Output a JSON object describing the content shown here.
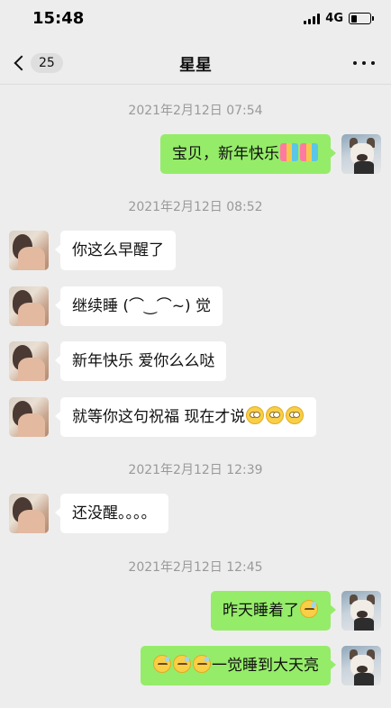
{
  "status_bar": {
    "time": "15:48",
    "network": "4G",
    "battery_level": 0.3
  },
  "nav": {
    "back_count": "25",
    "title": "星星"
  },
  "timestamps": [
    "2021年2月12日 07:54",
    "2021年2月12日 08:52",
    "2021年2月12日 12:39",
    "2021年2月12日 12:45"
  ],
  "messages": [
    {
      "side": "right",
      "text": "宝贝，新年快乐",
      "emojis": [
        "ribbon",
        "ribbon"
      ]
    },
    {
      "side": "left",
      "text": "你这么早醒了"
    },
    {
      "side": "left",
      "text": "继续睡 (⌒‿⌒~) 觉"
    },
    {
      "side": "left",
      "text": "新年快乐 爱你么么哒"
    },
    {
      "side": "left",
      "text": "就等你这句祝福 现在才说",
      "emojis": [
        "eyeroll",
        "eyeroll",
        "eyeroll"
      ]
    },
    {
      "side": "left",
      "text": "还没醒。。。。"
    },
    {
      "side": "right",
      "text": "昨天睡着了",
      "emojis": [
        "sleepy"
      ]
    },
    {
      "side": "right",
      "text": "一觉睡到大天亮",
      "emojis_before": [
        "sleepy",
        "sleepy",
        "sleepy"
      ]
    }
  ],
  "colors": {
    "background": "#ededed",
    "bubble_self": "#95ec69",
    "bubble_other": "#ffffff",
    "timestamp": "#999999"
  }
}
